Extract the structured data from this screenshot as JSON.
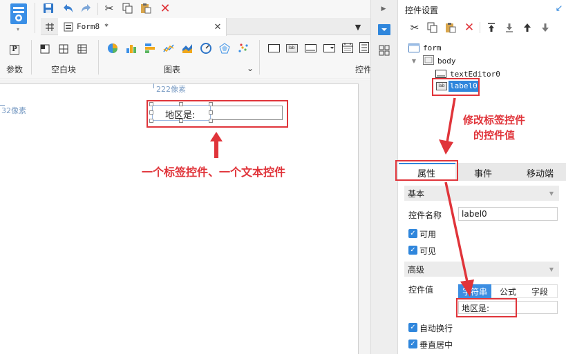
{
  "toolbar": {
    "doc_tab_label": "Form8 *",
    "groups": {
      "params": "参数",
      "blank_block": "空白块",
      "charts": "图表",
      "widgets": "控件"
    },
    "icons": {
      "params_icon": "P",
      "label_widget_text": "lab"
    }
  },
  "canvas": {
    "ruler_x": "222像素",
    "ruler_y": "32像素",
    "label_widget_text": "地区是:",
    "annotation": "一个标签控件、一个文本控件"
  },
  "right_panel": {
    "title": "控件设置",
    "tree": {
      "root": "form",
      "body": "body",
      "text_editor": "textEditor0",
      "label": "label0",
      "label_icon": "lab"
    },
    "annotation": "修改标签控件\n的控件值",
    "tabs": [
      "属性",
      "事件",
      "移动端"
    ],
    "basic_section": "基本",
    "name_label": "控件名称",
    "name_value": "label0",
    "enabled_label": "可用",
    "visible_label": "可见",
    "advanced_section": "高级",
    "value_label": "控件值",
    "value_tabs": [
      "字符串",
      "公式",
      "字段"
    ],
    "value_text": "地区是:",
    "auto_wrap_label": "自动换行",
    "vertical_center_label": "垂直居中"
  },
  "colors": {
    "accent": "#2f86dc",
    "annotation_red": "#e0343a",
    "selected_tab": "#3c8ee2"
  }
}
